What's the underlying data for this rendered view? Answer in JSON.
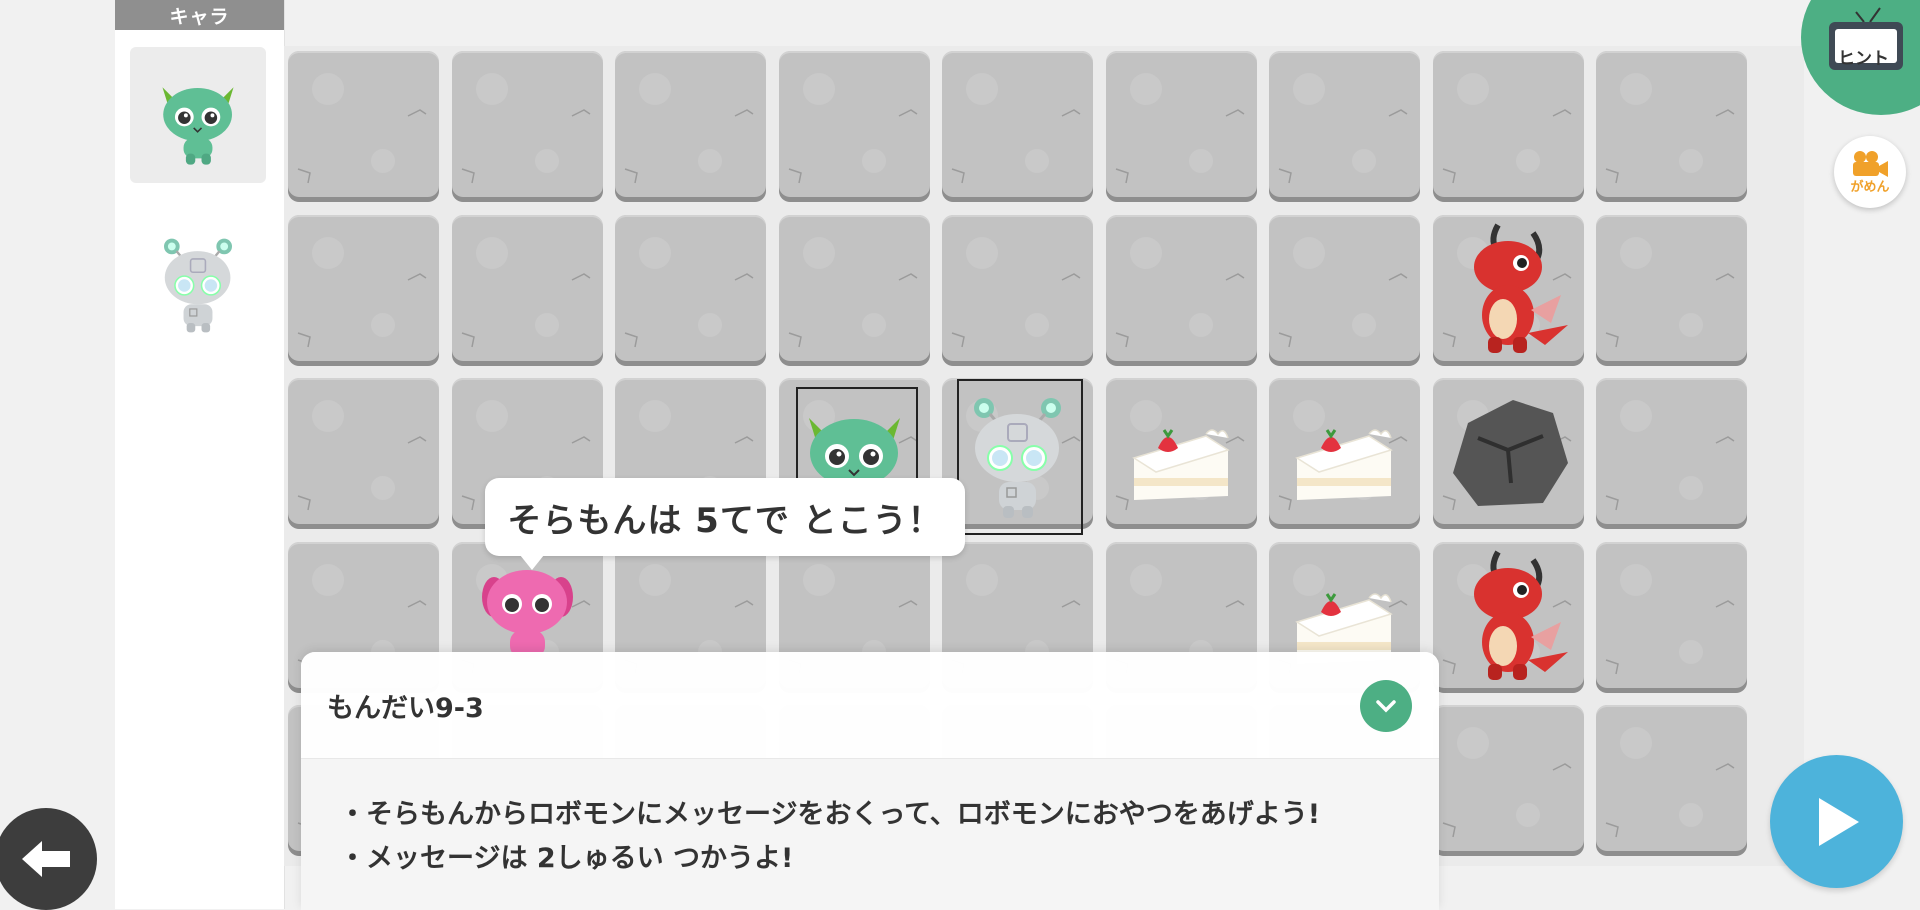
{
  "sidebar": {
    "header": "キャラ",
    "characters": [
      {
        "name": "そらもん",
        "icon": "green-monster-icon",
        "selected": true
      },
      {
        "name": "ロボモン",
        "icon": "robot-monster-icon",
        "selected": false
      }
    ]
  },
  "hint_button": {
    "label": "ヒント",
    "icon": "tv-icon"
  },
  "movie_button": {
    "label": "がめん",
    "icon": "video-camera-icon"
  },
  "board": {
    "columns": 9,
    "rows": 5,
    "items": [
      {
        "row": 1,
        "col": 7,
        "type": "dragon"
      },
      {
        "row": 2,
        "col": 3,
        "type": "green-monster"
      },
      {
        "row": 2,
        "col": 4,
        "type": "robot"
      },
      {
        "row": 2,
        "col": 5,
        "type": "cake"
      },
      {
        "row": 2,
        "col": 6,
        "type": "cake"
      },
      {
        "row": 2,
        "col": 7,
        "type": "rock"
      },
      {
        "row": 3,
        "col": 1,
        "type": "pink-monster"
      },
      {
        "row": 3,
        "col": 6,
        "type": "cake"
      },
      {
        "row": 3,
        "col": 7,
        "type": "dragon"
      }
    ]
  },
  "speech_bubble": {
    "text": "そらもんは 5てで とこう！"
  },
  "problem": {
    "title": "もんだい9-3",
    "lines": [
      "・そらもんからロボモンにメッセージをおくって、ロボモンにおやつをあげよう!",
      "・メッセージは 2しゅるい つかうよ!"
    ]
  },
  "colors": {
    "accent_green": "#4daf84",
    "play_blue": "#4db3db",
    "tile_gray": "#c2c2c2"
  }
}
